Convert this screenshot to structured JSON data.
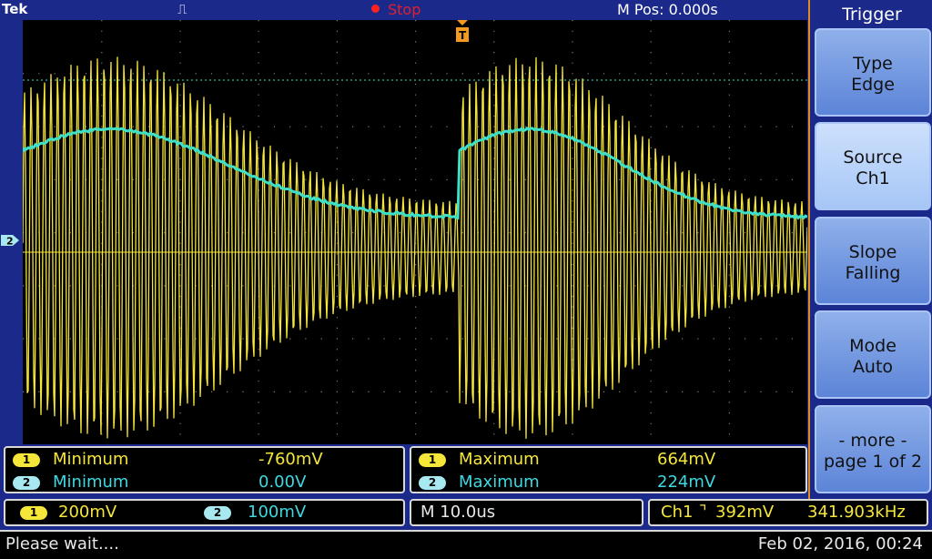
{
  "header": {
    "brand": "Tek",
    "trigger_glyph": "⎍",
    "acquisition_state": "Stop",
    "horizontal_position": "M Pos: 0.000s"
  },
  "channel2_marker": "2",
  "measurements_left": [
    {
      "channel": "1",
      "label": "Minimum",
      "value": "-760mV"
    },
    {
      "channel": "2",
      "label": "Minimum",
      "value": "0.00V"
    }
  ],
  "measurements_right": [
    {
      "channel": "1",
      "label": "Maximum",
      "value": "664mV"
    },
    {
      "channel": "2",
      "label": "Maximum",
      "value": "224mV"
    }
  ],
  "channel_scales": {
    "ch1_badge": "1",
    "ch1": "200mV",
    "ch2_badge": "2",
    "ch2": "100mV"
  },
  "timebase": "M 10.0us",
  "trigger_readout": {
    "source": "Ch1",
    "slope_symbol": "⌝",
    "level": "392mV",
    "frequency": "341.903kHz"
  },
  "status": {
    "message": "Please wait....",
    "datetime": "Feb 02, 2016, 00:24"
  },
  "side_menu": {
    "title": "Trigger",
    "buttons": [
      {
        "line1": "Type",
        "line2": "Edge"
      },
      {
        "line1": "Source",
        "line2": "Ch1"
      },
      {
        "line1": "Slope",
        "line2": "Falling"
      },
      {
        "line1": "Mode",
        "line2": "Auto"
      },
      {
        "line1": "- more -",
        "line2": "page 1 of 2"
      }
    ]
  },
  "colors": {
    "ch1": "#f5e63a",
    "ch2": "#3fe0c8",
    "stop": "#e0202a",
    "menu_border": "#e08a1e"
  }
}
